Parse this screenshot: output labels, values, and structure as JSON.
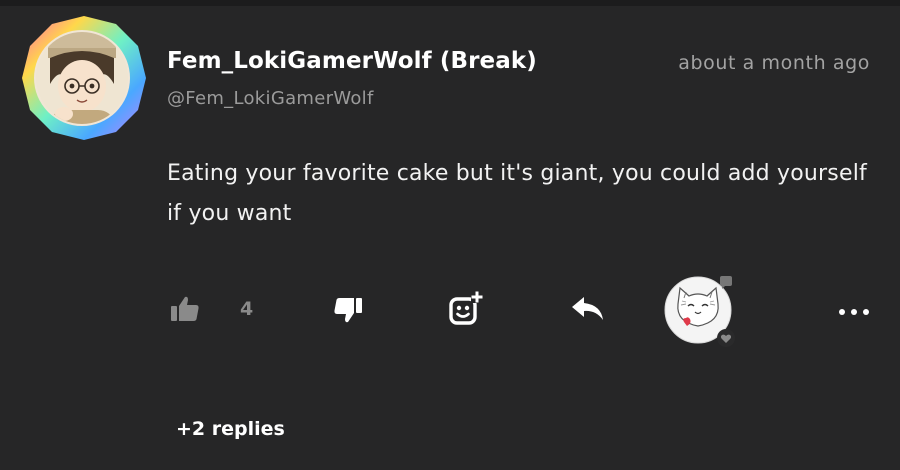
{
  "post": {
    "display_name": "Fem_LokiGamerWolf (Break)",
    "handle": "@Fem_LokiGamerWolf",
    "timestamp": "about a month ago",
    "text": "Eating your favorite cake but it's giant, you could add yourself if you want"
  },
  "actions": {
    "like_icon": "thumbs-up-icon",
    "like_count": "4",
    "dislike_icon": "thumbs-down-icon",
    "sticker_icon": "add-sticker-icon",
    "reply_icon": "reply-arrow-icon",
    "reactor_icon": "reactor-avatar",
    "more_icon": "more-options-icon"
  },
  "replies": {
    "label": "+2 replies"
  },
  "colors": {
    "background": "#262627",
    "text_primary": "#ffffff",
    "text_secondary": "#a3a3a3",
    "icon_muted": "#8a8a8a"
  }
}
